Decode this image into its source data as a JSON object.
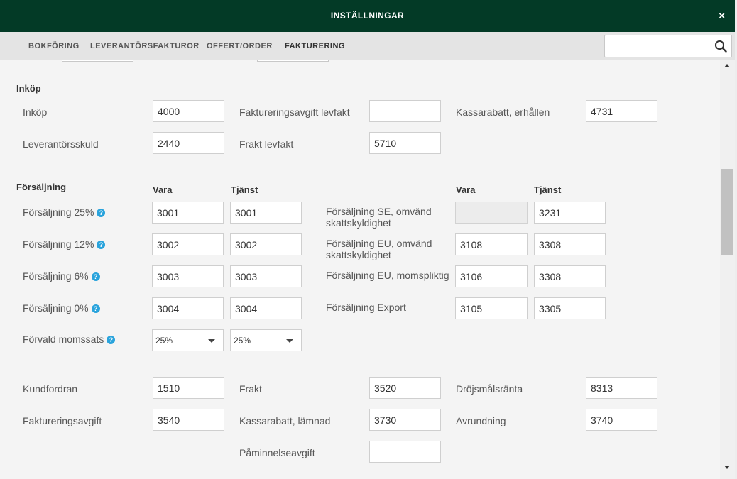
{
  "window": {
    "title": "INSTÄLLNINGAR",
    "close_label": "×"
  },
  "tabs": [
    "BOKFÖRING",
    "LEVERANTÖRSFAKTUROR",
    "OFFERT/ORDER",
    "FAKTURERING"
  ],
  "search": {
    "value": "",
    "placeholder": ""
  },
  "inkop": {
    "heading": "Inköp",
    "inkop": {
      "label": "Inköp",
      "value": "4000"
    },
    "leverantorsskuld": {
      "label": "Leverantörsskuld",
      "value": "2440"
    },
    "faktureringsavgift_levfakt": {
      "label": "Faktureringsavgift levfakt",
      "value": ""
    },
    "frakt_levfakt": {
      "label": "Frakt levfakt",
      "value": "5710"
    },
    "kassarabatt_erhallen": {
      "label": "Kassarabatt, erhållen",
      "value": "4731"
    }
  },
  "forsaljning": {
    "heading": "Försäljning",
    "col_vara": "Vara",
    "col_tjanst": "Tjänst",
    "left_rows": [
      {
        "label": "Försäljning 25%",
        "vara": "3001",
        "tjanst": "3001"
      },
      {
        "label": "Försäljning 12%",
        "vara": "3002",
        "tjanst": "3002"
      },
      {
        "label": "Försäljning 6%",
        "vara": "3003",
        "tjanst": "3003"
      },
      {
        "label": "Försäljning 0%",
        "vara": "3004",
        "tjanst": "3004"
      }
    ],
    "right_rows": [
      {
        "label": "Försäljning SE, omvänd skattskyldighet",
        "vara": "",
        "tjanst": "3231"
      },
      {
        "label": "Försäljning EU, omvänd skattskyldighet",
        "vara": "3108",
        "tjanst": "3308"
      },
      {
        "label": "Försäljning EU, momspliktig",
        "vara": "3106",
        "tjanst": "3308"
      },
      {
        "label": "Försäljning Export",
        "vara": "3105",
        "tjanst": "3305"
      }
    ],
    "forvald_momssats": {
      "label": "Förvald momssats",
      "vara": "25%",
      "tjanst": "25%"
    }
  },
  "ovrigt": {
    "kundfordran": {
      "label": "Kundfordran",
      "value": "1510"
    },
    "faktureringsavgift": {
      "label": "Faktureringsavgift",
      "value": "3540"
    },
    "frakt": {
      "label": "Frakt",
      "value": "3520"
    },
    "kassarabatt_lamnad": {
      "label": "Kassarabatt, lämnad",
      "value": "3730"
    },
    "paminnelseavgift": {
      "label": "Påminnelseavgift",
      "value": ""
    },
    "drojsmalsranta": {
      "label": "Dröjsmålsränta",
      "value": "8313"
    },
    "avrundning": {
      "label": "Avrundning",
      "value": "3740"
    }
  },
  "help_glyph": "?",
  "colors": {
    "titlebar": "#033a26",
    "help": "#29a3dc"
  }
}
